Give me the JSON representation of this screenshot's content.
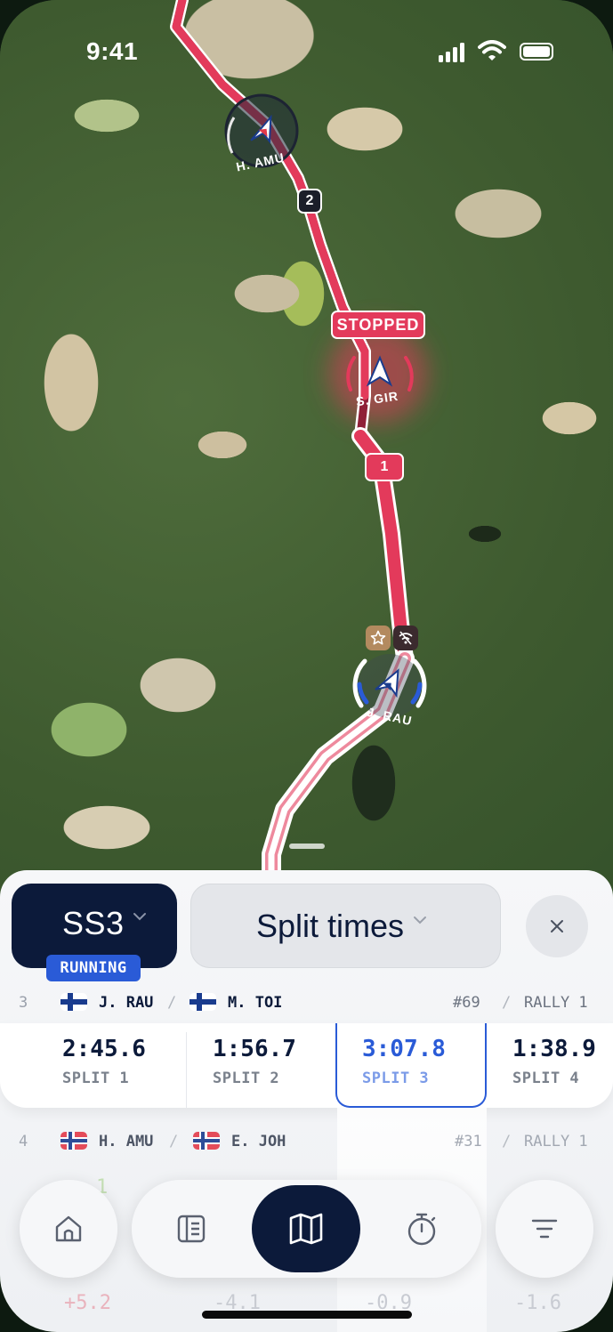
{
  "status_bar": {
    "time": "9:41"
  },
  "map": {
    "markers": [
      {
        "name": "H. AMU"
      },
      {
        "name": "S. GIR",
        "status": "STOPPED"
      },
      {
        "name": "J. RAU"
      }
    ],
    "split_badges": [
      "2",
      "1"
    ],
    "colors": {
      "route": "#e33a5b",
      "route_dark": "#8f2038",
      "stopped": "#e33a5b"
    }
  },
  "stage": {
    "label": "SS3",
    "status": "RUNNING"
  },
  "view": {
    "label": "Split times"
  },
  "rows": [
    {
      "position": "3",
      "driver": "J. RAU",
      "codriver": "M. TOI",
      "car_number": "#69",
      "class": "RALLY 1",
      "splits": [
        {
          "time": "2:45.6",
          "label": "SPLIT 1"
        },
        {
          "time": "1:56.7",
          "label": "SPLIT 2"
        },
        {
          "time": "3:07.8",
          "label": "SPLIT 3"
        },
        {
          "time": "1:38.9",
          "label": "SPLIT 4"
        }
      ]
    },
    {
      "position": "4",
      "driver": "H. AMU",
      "codriver": "E. JOH",
      "car_number": "#31",
      "class": "RALLY 1"
    }
  ],
  "partial_row": {
    "gaps": [
      "+5.2",
      "-4.1",
      "-0.9",
      "-1.6"
    ],
    "first_digit": "1"
  },
  "nav": {
    "items": [
      {
        "icon": "home-icon"
      },
      {
        "icon": "list-icon"
      },
      {
        "icon": "map-icon",
        "active": true
      },
      {
        "icon": "stopwatch-icon"
      },
      {
        "icon": "filter-icon"
      }
    ]
  },
  "accent": "#2a5bd7",
  "navy": "#0c1a3a"
}
